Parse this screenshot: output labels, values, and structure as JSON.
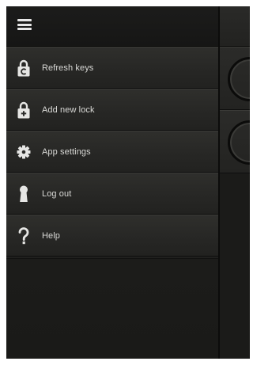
{
  "header": {
    "menu_icon": "hamburger-menu-icon"
  },
  "menu": {
    "items": [
      {
        "label": "Refresh keys",
        "icon": "lock-refresh-icon"
      },
      {
        "label": "Add new lock",
        "icon": "lock-add-icon"
      },
      {
        "label": "App settings",
        "icon": "gear-icon"
      },
      {
        "label": "Log out",
        "icon": "keyhole-icon"
      },
      {
        "label": "Help",
        "icon": "question-icon"
      }
    ]
  },
  "colors": {
    "background": "#1e1e1c",
    "item_text": "#d9d9d6",
    "icon": "#e6e6e4"
  }
}
